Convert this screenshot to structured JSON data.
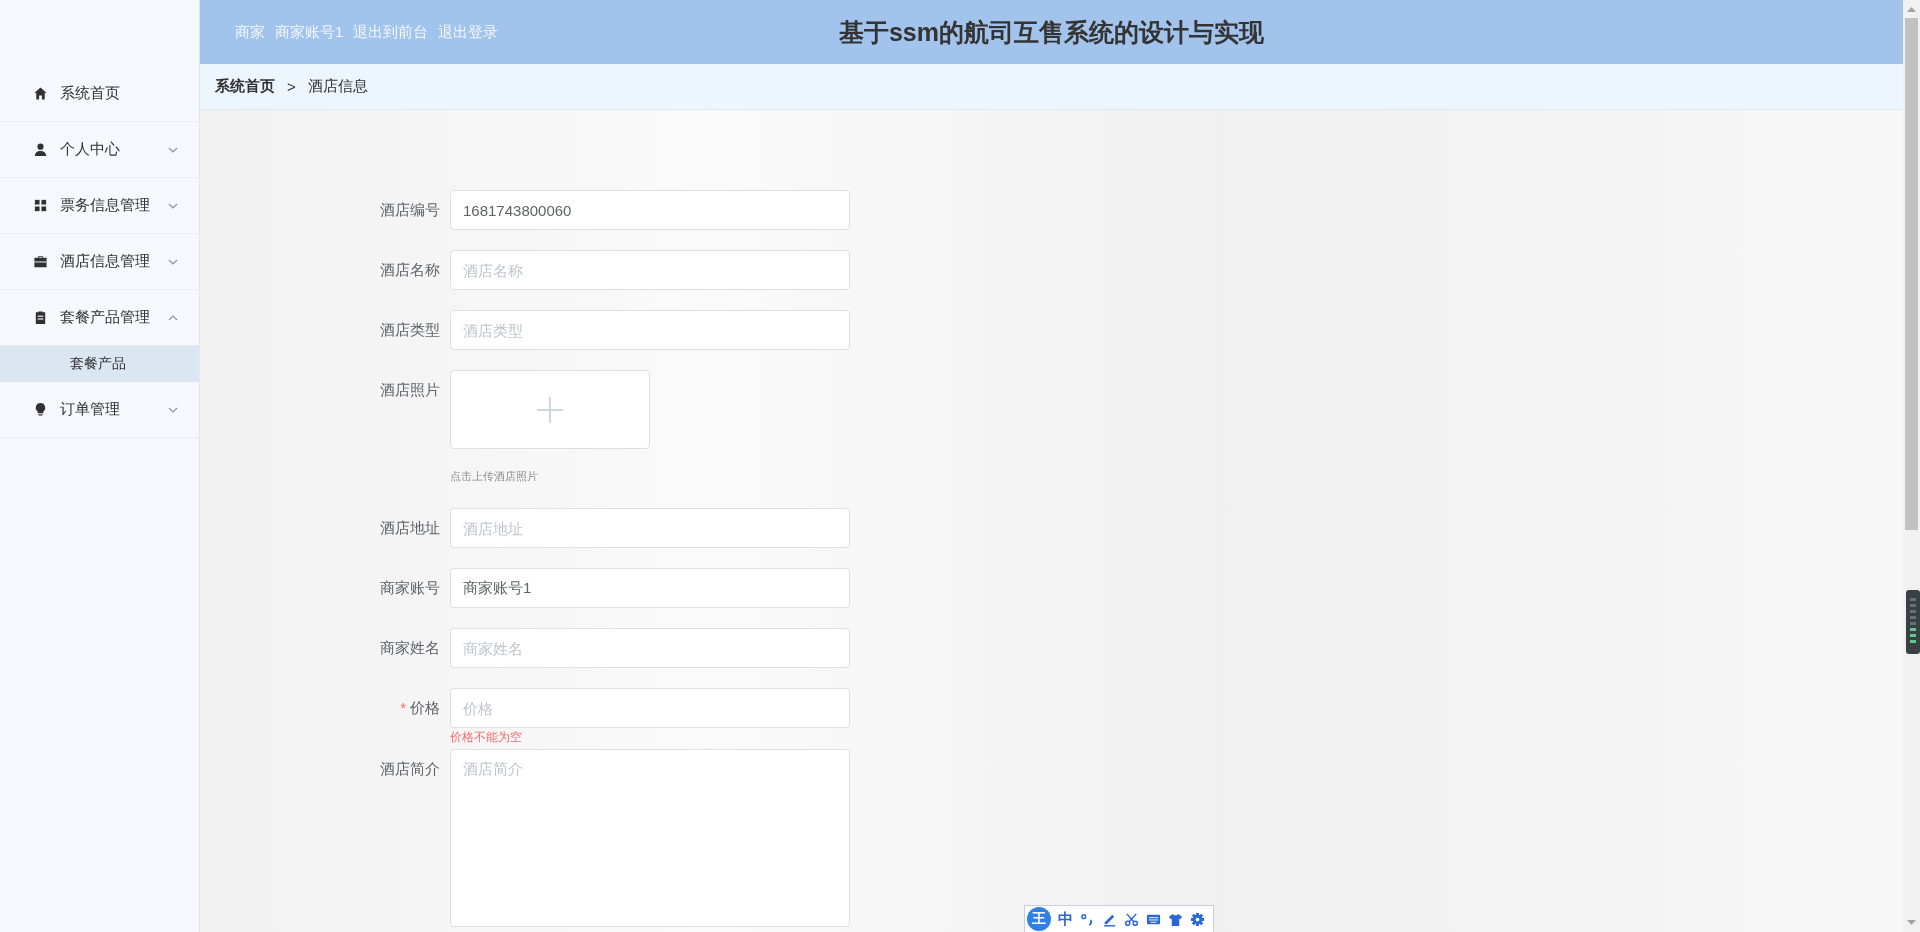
{
  "header": {
    "role": "商家",
    "username": "商家账号1",
    "links": [
      "退出到前台",
      "退出登录"
    ],
    "title": "基于ssm的航司互售系统的设计与实现"
  },
  "sidebar": {
    "items": [
      {
        "label": "系统首页",
        "kind": "home"
      },
      {
        "label": "个人中心",
        "kind": "user",
        "expanded": false
      },
      {
        "label": "票务信息管理",
        "kind": "grid",
        "expanded": false
      },
      {
        "label": "酒店信息管理",
        "kind": "briefcase",
        "expanded": false
      },
      {
        "label": "套餐产品管理",
        "kind": "clipboard",
        "expanded": true,
        "children": [
          {
            "label": "套餐产品",
            "selected": true
          }
        ]
      },
      {
        "label": "订单管理",
        "kind": "bulb",
        "expanded": false
      }
    ]
  },
  "breadcrumb": {
    "items": [
      "系统首页",
      "酒店信息"
    ],
    "separator": ">"
  },
  "form": {
    "fields": [
      {
        "kind": "input",
        "label": "酒店编号",
        "value": "1681743800060"
      },
      {
        "kind": "input",
        "label": "酒店名称",
        "placeholder": "酒店名称"
      },
      {
        "kind": "input",
        "label": "酒店类型",
        "placeholder": "酒店类型"
      },
      {
        "kind": "upload",
        "label": "酒店照片",
        "hint": "点击上传酒店照片"
      },
      {
        "kind": "input",
        "label": "酒店地址",
        "placeholder": "酒店地址"
      },
      {
        "kind": "input",
        "label": "商家账号",
        "value": "商家账号1"
      },
      {
        "kind": "input",
        "label": "商家姓名",
        "placeholder": "商家姓名"
      },
      {
        "kind": "input",
        "label": "价格",
        "placeholder": "价格",
        "required_mark": "*",
        "error": "价格不能为空"
      },
      {
        "kind": "textarea",
        "label": "酒店简介",
        "placeholder": "酒店简介"
      }
    ]
  },
  "ime_toolbar": {
    "logo": "王",
    "mode": "中"
  }
}
